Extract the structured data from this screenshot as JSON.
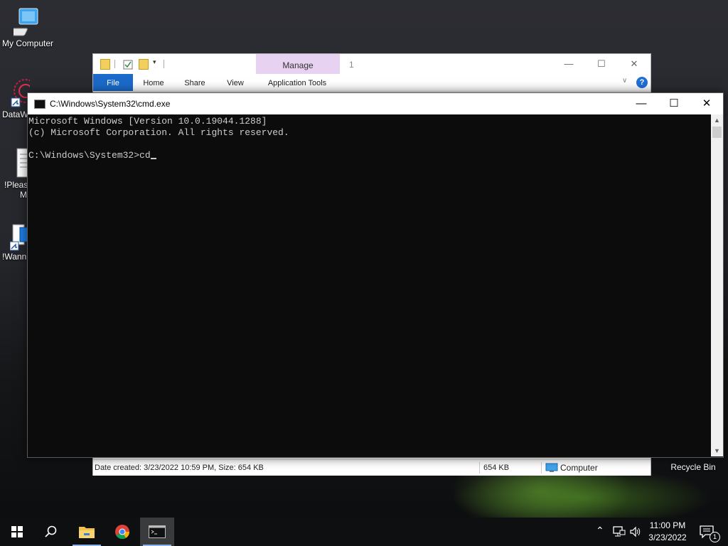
{
  "desktop": {
    "icons": [
      {
        "label": "My Computer"
      },
      {
        "label": "DataW"
      },
      {
        "label": "!Please"
      },
      {
        "label": "M"
      },
      {
        "label": "!Wann"
      },
      {
        "label": "Recycle Bin"
      }
    ]
  },
  "explorer": {
    "title_number": "1",
    "context_tab": "Manage",
    "ribbon_tabs": [
      "File",
      "Home",
      "Share",
      "View",
      "Application Tools"
    ],
    "status": {
      "left": "Date created: 3/23/2022 10:59 PM, Size: 654 KB",
      "size": "654 KB",
      "location": "Computer"
    }
  },
  "cmd": {
    "title": "C:\\Windows\\System32\\cmd.exe",
    "lines": [
      "Microsoft Windows [Version 10.0.19044.1288]",
      "(c) Microsoft Corporation. All rights reserved.",
      "",
      "C:\\Windows\\System32>cd"
    ]
  },
  "taskbar": {
    "time": "11:00 PM",
    "date": "3/23/2022",
    "notification_count": "1"
  },
  "colors": {
    "explorer_file_tab": "#1b6ac9",
    "manage_tab": "#e8d2f2",
    "console_bg": "#0c0c0c",
    "console_text": "#cccccc",
    "taskbar_bg": "#0e0f10"
  }
}
